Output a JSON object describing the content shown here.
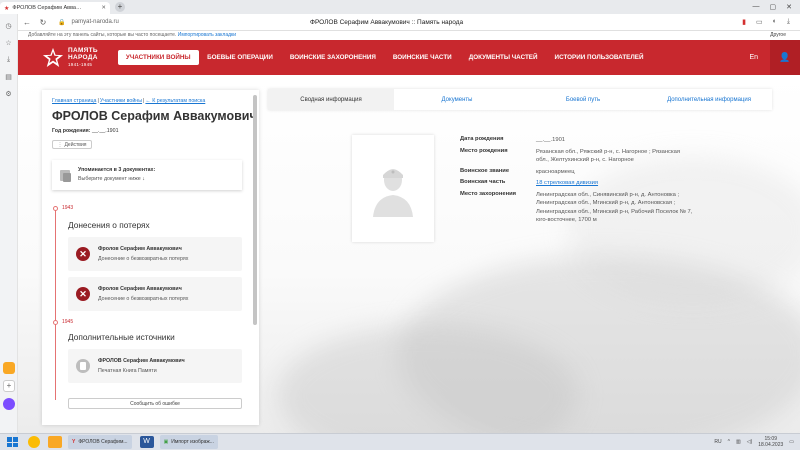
{
  "browser": {
    "tab_title": "ФРОЛОВ Серафим Авва…",
    "window_title": "ФРОЛОВ Серафим Аввакумович :: Память народа",
    "url": "pamyat-naroda.ru",
    "bookmark_hint": "Добавляйте на эту панель сайты, которые вы часто посещаете.",
    "bookmark_link": "Импортировать закладки",
    "other_bookmarks": "Другое"
  },
  "site": {
    "logo_line1": "ПАМЯТЬ",
    "logo_line2": "НАРОДА",
    "logo_years": "1941-1945",
    "menu": [
      {
        "label": "УЧАСТНИКИ ВОЙНЫ",
        "active": true
      },
      {
        "label": "БОЕВЫЕ ОПЕРАЦИИ",
        "active": false
      },
      {
        "label": "ВОИНСКИЕ ЗАХОРОНЕНИЯ",
        "active": false
      },
      {
        "label": "ВОИНСКИЕ ЧАСТИ",
        "active": false
      },
      {
        "label": "ДОКУМЕНТЫ ЧАСТЕЙ",
        "active": false
      },
      {
        "label": "ИСТОРИИ ПОЛЬЗОВАТЕЛЕЙ",
        "active": false
      }
    ],
    "lang": "En"
  },
  "person": {
    "breadcrumb": [
      "Главная страница",
      "Участники войны",
      "← К результатам поиска"
    ],
    "name": "ФРОЛОВ Серафим Аввакумович",
    "birth_label": "Год рождения:",
    "birth_value": "__.__.1901",
    "action_label": "Действия"
  },
  "mention": {
    "title": "Упоминается в 3 документах:",
    "subtitle": "Выберите документ ниже ↓"
  },
  "timeline": [
    {
      "year": "1943",
      "section": "Донесения о потерях",
      "docs": [
        {
          "name": "Фролов Серафим Аввакумович",
          "type": "Донесение о безвозвратных потерях"
        },
        {
          "name": "Фролов Серафим Аввакумович",
          "type": "Донесение о безвозвратных потерях"
        }
      ]
    },
    {
      "year": "1945",
      "section": "Дополнительные источники",
      "docs": [
        {
          "name": "ФРОЛОВ Серафим Аввакумович",
          "type": "Печатная Книга Памяти"
        }
      ]
    }
  ],
  "report_button": "Сообщить об ошибке",
  "tabs": [
    {
      "label": "Сводная информация",
      "active": true
    },
    {
      "label": "Документы",
      "active": false
    },
    {
      "label": "Боевой путь",
      "active": false
    },
    {
      "label": "Дополнительная информация",
      "active": false
    }
  ],
  "info": {
    "birth_date_label": "Дата рождения",
    "birth_date": "__.__.1901",
    "birth_place_label": "Место рождения",
    "birth_place": "Рязанская обл., Ряжский р-н, с. Нагорное ; Рязанская обл., Желтухинский р-н, с. Нагорное",
    "rank_label": "Воинское звание",
    "rank": "красноармеец",
    "unit_label": "Воинская часть",
    "unit": "18 стрелковая дивизия",
    "burial_label": "Место захоронения",
    "burial": "Ленинградская обл., Синявинский р-н, д. Антоновка ; Ленинградская обл., Мгинский р-н, д. Антоновская ; Ленинградская обл., Мгинский р-н, Рабочий Поселок № 7, юго-восточнее, 1700 м"
  },
  "taskbar": {
    "task1": "ФРОЛОВ Серафим...",
    "task2": "Импорт изображ...",
    "lang": "RU",
    "time": "15:09",
    "date": "18.04.2023"
  },
  "colors": {
    "brand_red": "#c8282e",
    "link_blue": "#1976d2"
  }
}
